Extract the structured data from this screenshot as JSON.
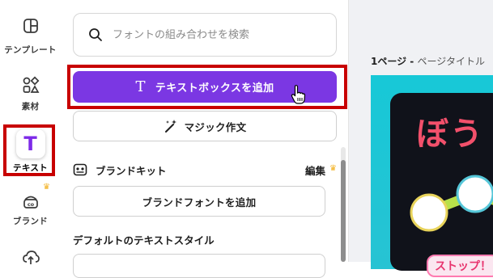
{
  "rail": {
    "items": [
      {
        "label": "テンプレート",
        "icon": "template-icon"
      },
      {
        "label": "素材",
        "icon": "elements-icon"
      },
      {
        "label": "テキスト",
        "icon": "text-icon"
      },
      {
        "label": "ブランド",
        "icon": "brand-icon"
      }
    ],
    "active_index": 2
  },
  "panel": {
    "search": {
      "placeholder": "フォントの組み合わせを検索",
      "value": ""
    },
    "add_textbox_label": "テキストボックスを追加",
    "add_textbox_glyph": "T",
    "magic_write_label": "マジック作文",
    "brand_kit": {
      "title": "ブランドキット",
      "edit_label": "編集"
    },
    "add_brand_font_label": "ブランドフォントを追加",
    "default_styles_title": "デフォルトのテキストスタイル"
  },
  "canvas": {
    "page_number": "1ページ",
    "separator": " - ",
    "page_title_placeholder": "ページタイトル",
    "design_title_text": "ぼう",
    "badge_text": "ストップ！"
  },
  "colors": {
    "accent": "#7b37e3",
    "highlight": "#c80000",
    "crown": "#f2b01e"
  }
}
